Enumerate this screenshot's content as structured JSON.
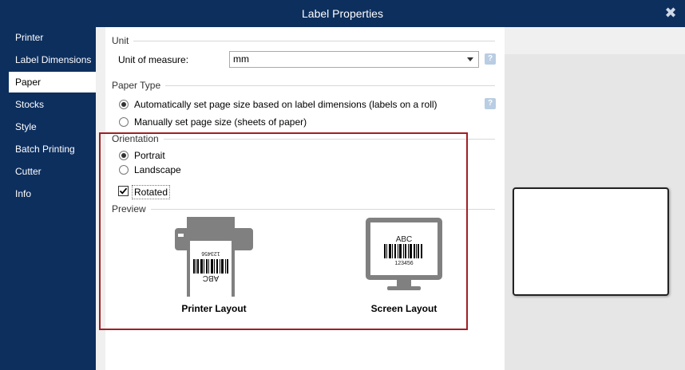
{
  "window": {
    "title": "Label Properties",
    "close_glyph": "✖"
  },
  "sidebar": {
    "items": [
      {
        "label": "Printer",
        "active": false
      },
      {
        "label": "Label Dimensions",
        "active": false
      },
      {
        "label": "Paper",
        "active": true
      },
      {
        "label": "Stocks",
        "active": false
      },
      {
        "label": "Style",
        "active": false
      },
      {
        "label": "Batch Printing",
        "active": false
      },
      {
        "label": "Cutter",
        "active": false
      },
      {
        "label": "Info",
        "active": false
      }
    ]
  },
  "unit": {
    "section": "Unit",
    "measure_label": "Unit of measure:",
    "measure_value": "mm"
  },
  "paper_type": {
    "section": "Paper Type",
    "auto_label": "Automatically set page size based on label dimensions (labels on a roll)",
    "manual_label": "Manually set page size (sheets of paper)",
    "selected": "auto"
  },
  "orientation": {
    "section": "Orientation",
    "portrait_label": "Portrait",
    "landscape_label": "Landscape",
    "selected": "portrait",
    "rotated_label": "Rotated",
    "rotated_checked": true
  },
  "preview": {
    "section": "Preview",
    "printer_caption": "Printer Layout",
    "screen_caption": "Screen Layout",
    "label_text": "ABC",
    "label_number": "123456"
  },
  "icons": {
    "help": "?",
    "highlight_color": "#a01f24",
    "accent": "#0d2f5e"
  }
}
